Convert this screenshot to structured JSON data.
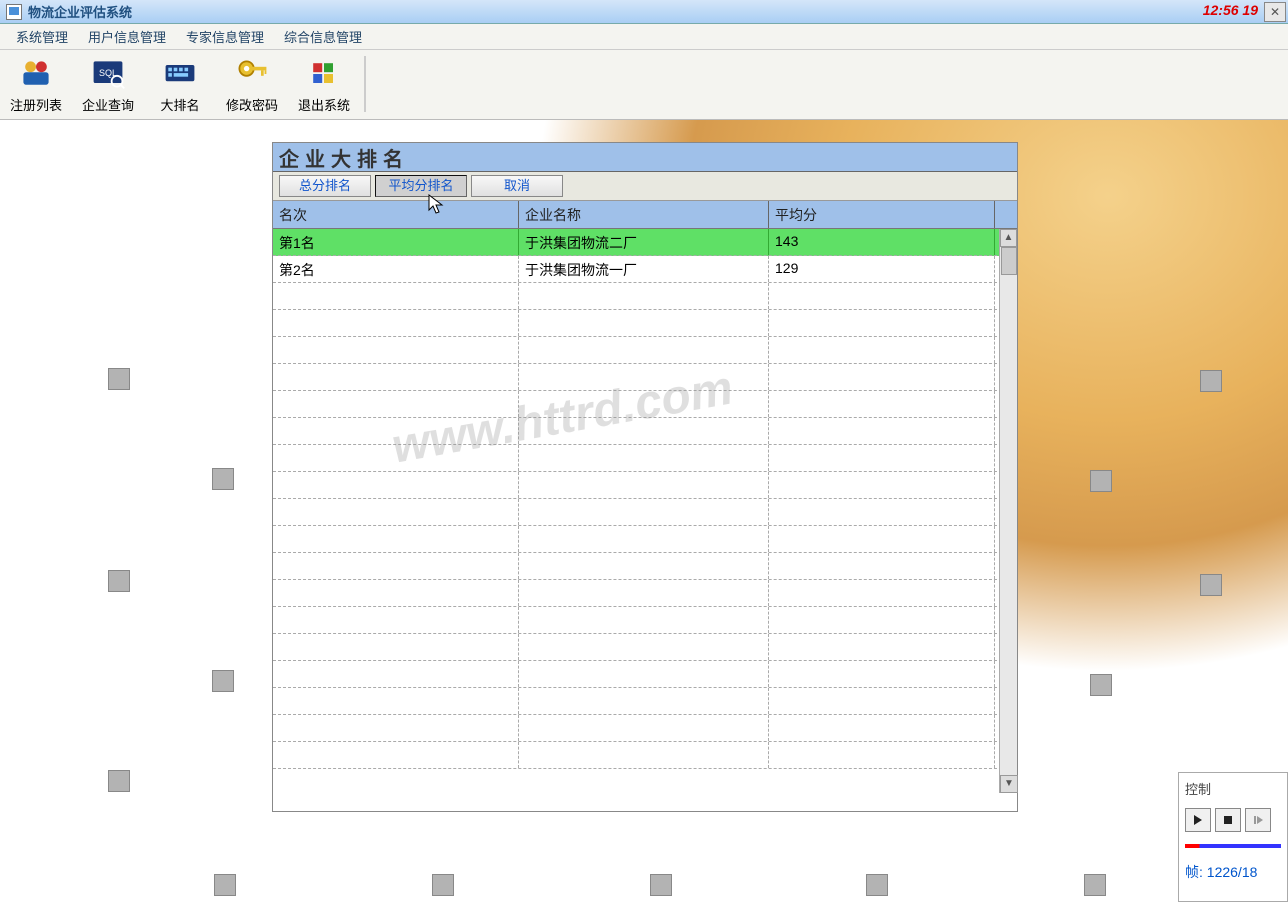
{
  "window": {
    "title": "物流企业评估系统",
    "time_badge": "12:56 19"
  },
  "menubar": {
    "items": [
      "系统管理",
      "用户信息管理",
      "专家信息管理",
      "综合信息管理"
    ]
  },
  "toolbar": {
    "items": [
      {
        "label": "注册列表"
      },
      {
        "label": "企业查询"
      },
      {
        "label": "大排名"
      },
      {
        "label": "修改密码"
      },
      {
        "label": "退出系统"
      }
    ]
  },
  "inner": {
    "title": "企业大排名",
    "buttons": {
      "total": "总分排名",
      "avg": "平均分排名",
      "cancel": "取消"
    },
    "columns": {
      "rank": "名次",
      "name": "企业名称",
      "avg": "平均分"
    },
    "rows": [
      {
        "rank": "第1名",
        "name": "于洪集团物流二厂",
        "avg": "143"
      },
      {
        "rank": "第2名",
        "name": "于洪集团物流一厂",
        "avg": "129"
      }
    ]
  },
  "panel": {
    "title": "控制",
    "frame_label": "帧:",
    "frame_value": "1226/18"
  },
  "watermark": "www.httrd.com"
}
